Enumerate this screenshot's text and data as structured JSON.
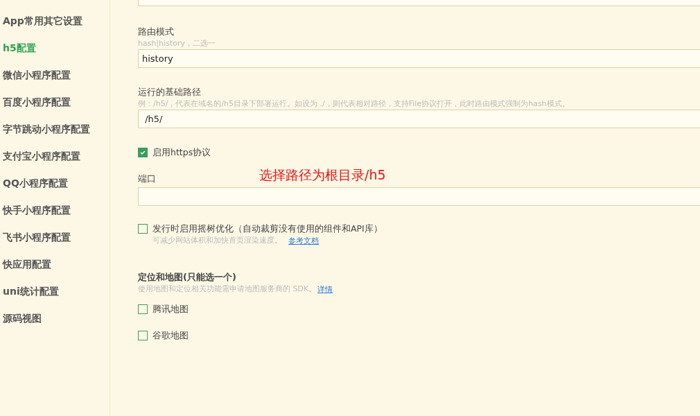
{
  "sidebar": {
    "items": [
      {
        "label": "App常用其它设置",
        "selected": false
      },
      {
        "label": "h5配置",
        "selected": true
      },
      {
        "label": "微信小程序配置",
        "selected": false
      },
      {
        "label": "百度小程序配置",
        "selected": false
      },
      {
        "label": "字节跳动小程序配置",
        "selected": false
      },
      {
        "label": "支付宝小程序配置",
        "selected": false
      },
      {
        "label": "QQ小程序配置",
        "selected": false
      },
      {
        "label": "快手小程序配置",
        "selected": false
      },
      {
        "label": "飞书小程序配置",
        "selected": false
      },
      {
        "label": "快应用配置",
        "selected": false
      },
      {
        "label": "uni统计配置",
        "selected": false
      },
      {
        "label": "源码视图",
        "selected": false
      }
    ]
  },
  "fields": [
    {
      "kind": "input",
      "label": "路由模式",
      "hint": "hash|history，二选一",
      "value": "history"
    },
    {
      "kind": "input",
      "label": "运行的基础路径",
      "hint": "例：/h5/，代表在域名的/h5目录下部署运行。如设为 ./，则代表相对路径，支持File协议打开，此时路由模式强制为hash模式。",
      "value": " /h5/"
    },
    {
      "kind": "checkbox",
      "label": "启用https协议",
      "checked": true
    },
    {
      "kind": "input",
      "label": "端口"
    },
    {
      "kind": "checkbox",
      "label": "发行时启用摇树优化（自动裁剪没有使用的组件和API库）",
      "checked": false,
      "hint": "可减少网站体积和加快首页渲染速度。",
      "link": "参考文档"
    },
    {
      "kind": "section",
      "label": "定位和地图(只能选一个)",
      "hint": "使用地图和定位相关功能需申请地图服务商的 SDK。",
      "link": "详情"
    },
    {
      "kind": "checkbox",
      "label": "腾讯地图",
      "checked": false
    },
    {
      "kind": "checkbox",
      "label": "谷歌地图",
      "checked": false
    }
  ],
  "annotation": "选择路径为根目录/h5"
}
